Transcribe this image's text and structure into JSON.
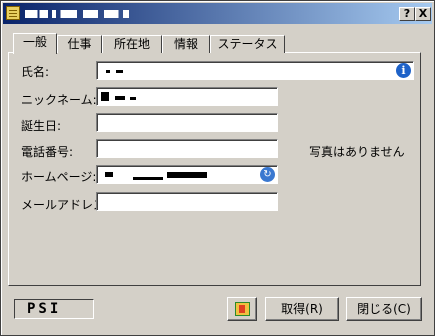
{
  "window": {
    "help_button": "?",
    "close_button": "X"
  },
  "tabs": [
    {
      "label": "一般"
    },
    {
      "label": "仕事"
    },
    {
      "label": "所在地"
    },
    {
      "label": "情報"
    },
    {
      "label": "ステータス"
    }
  ],
  "fields": {
    "name_label": "氏名:",
    "nickname_label": "ニックネーム:",
    "birthday_label": "誕生日:",
    "phone_label": "電話番号:",
    "homepage_label": "ホームページ:",
    "email_label": "メールアドレス:",
    "birthday_value": "",
    "phone_value": "",
    "email_value": ""
  },
  "photo": {
    "no_photo_text": "写真はありません"
  },
  "buttons": {
    "fetch": "取得(R)",
    "close": "閉じる(C)"
  },
  "status": {
    "text": "PSI"
  },
  "icons": {
    "info": "i",
    "go": "arrow-icon"
  }
}
